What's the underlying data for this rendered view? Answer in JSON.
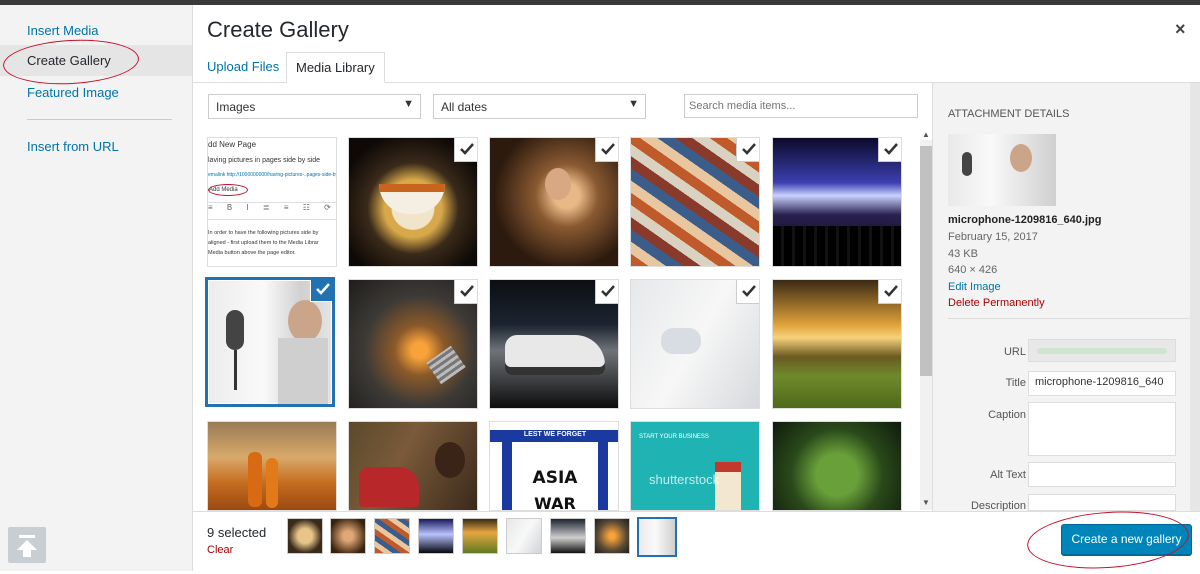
{
  "left_menu": {
    "items": [
      {
        "label": "Insert Media"
      },
      {
        "label": "Create Gallery"
      },
      {
        "label": "Featured Image"
      },
      {
        "label": "Insert from URL"
      }
    ]
  },
  "modal": {
    "title": "Create Gallery",
    "close_symbol": "×",
    "tabs": [
      {
        "label": "Upload Files"
      },
      {
        "label": "Media Library"
      }
    ]
  },
  "filters": {
    "type_value": "Images",
    "date_value": "All dates",
    "search_placeholder": "Search media items..."
  },
  "grid": {
    "doc_lines": [
      "dd New Page",
      "laving pictures in pages side by side",
      "emalink http://1000000000/having-pictures-..pages-side-by",
      "Add Media",
      "In order to have the following pictures side by",
      "aligned - first upload them to the Media Librar",
      "Media button above the page editor."
    ],
    "poster_lines": [
      "LEST WE FORGET",
      "ASIA",
      "WAR"
    ],
    "banner_lines": [
      "START YOUR BUSINESS",
      "shutterstock"
    ]
  },
  "details": {
    "heading": "ATTACHMENT DETAILS",
    "filename": "microphone-1209816_640.jpg",
    "date": "February 15, 2017",
    "size": "43 KB",
    "dimensions": "640 × 426",
    "edit_label": "Edit Image",
    "delete_label": "Delete Permanently",
    "fields": {
      "url_label": "URL",
      "title_label": "Title",
      "title_value": "microphone-1209816_640",
      "caption_label": "Caption",
      "alt_label": "Alt Text",
      "description_label": "Description"
    }
  },
  "bottom": {
    "selected_count": "9 selected",
    "clear_label": "Clear",
    "create_button": "Create a new gallery"
  },
  "colors": {
    "accent": "#0085ba",
    "link": "#0073aa",
    "danger": "#a00000",
    "annotation": "#c8102e"
  },
  "icons": [
    "check-icon",
    "upload-icon",
    "close-icon",
    "chevron-down-icon"
  ]
}
